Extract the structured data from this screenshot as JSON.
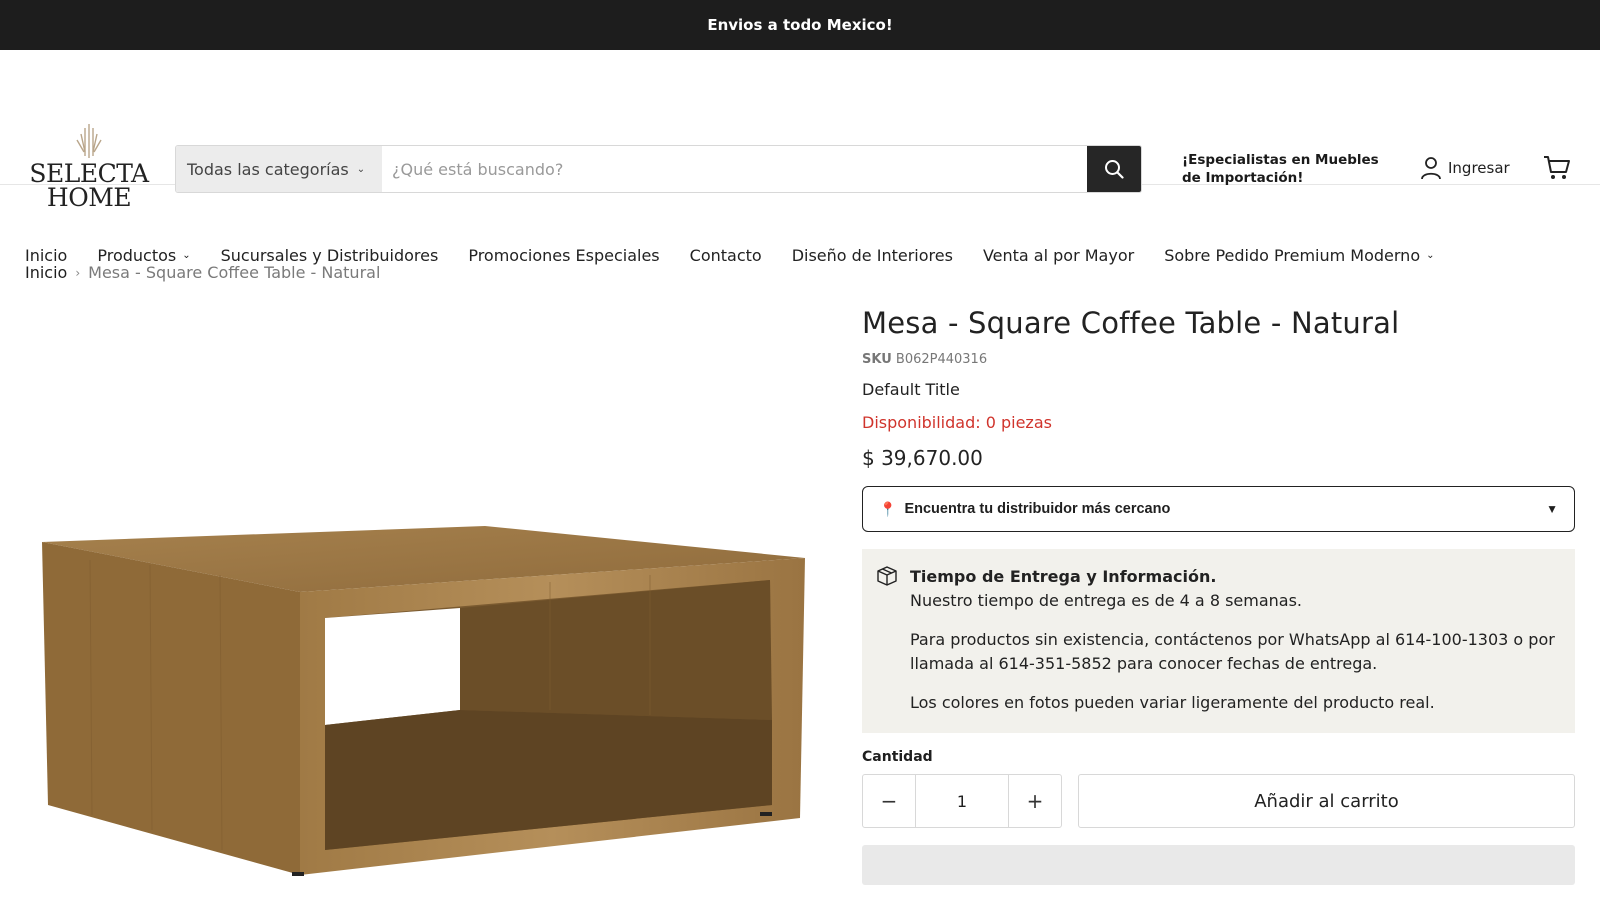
{
  "announcement": "Envios a todo Mexico!",
  "logo": {
    "line1": "SELECTA",
    "line2": "HOME"
  },
  "search": {
    "category": "Todas las categorías",
    "placeholder": "¿Qué está buscando?"
  },
  "tagline": "¡Especialistas en Muebles de Importación!",
  "login_label": "Ingresar",
  "nav": [
    {
      "label": "Inicio"
    },
    {
      "label": "Productos"
    },
    {
      "label": "Sucursales y Distribuidores"
    },
    {
      "label": "Promociones Especiales"
    },
    {
      "label": "Contacto"
    },
    {
      "label": "Diseño de Interiores"
    },
    {
      "label": "Venta al por Mayor"
    },
    {
      "label": "Sobre Pedido Premium Moderno"
    }
  ],
  "breadcrumb": {
    "home": "Inicio",
    "separator": "›",
    "current": "Mesa - Square Coffee Table - Natural"
  },
  "product": {
    "title": "Mesa - Square Coffee Table - Natural",
    "sku_label": "SKU",
    "sku": "B062P440316",
    "variant": "Default Title",
    "availability": "Disponibilidad: 0 piezas",
    "price": "$ 39,670.00",
    "distributor_label": "Encuentra tu distribuidor más cercano",
    "delivery": {
      "heading": "Tiempo de Entrega y Información.",
      "line1": "Nuestro tiempo de entrega es de 4 a 8 semanas.",
      "line2": "Para productos sin existencia, contáctenos por WhatsApp al 614-100-1303 o por llamada al 614-351-5852 para conocer fechas de entrega.",
      "line3": "Los colores en fotos pueden variar ligeramente del producto real."
    },
    "quantity_label": "Cantidad",
    "quantity": "1",
    "add_to_cart": "Añadir al carrito"
  },
  "colors": {
    "accent_red": "#d0342c",
    "dark": "#1d1d1d",
    "info_bg": "#f2f1ec"
  }
}
